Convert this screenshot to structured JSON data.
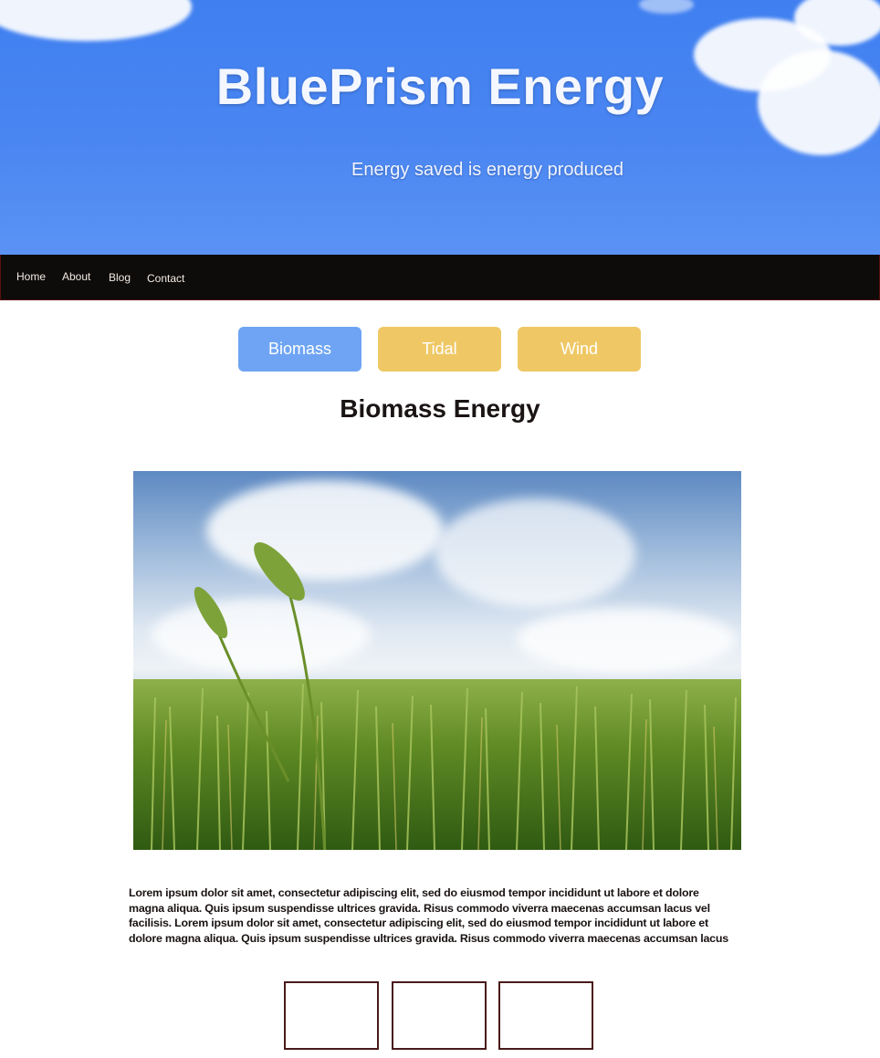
{
  "hero": {
    "title": "BluePrism Energy",
    "tagline": "Energy saved is energy produced"
  },
  "nav": {
    "items": [
      {
        "label": "Home"
      },
      {
        "label": "About"
      },
      {
        "label": "Blog"
      },
      {
        "label": "Contact"
      }
    ]
  },
  "tabs": [
    {
      "label": "Biomass",
      "active": true
    },
    {
      "label": "Tidal",
      "active": false
    },
    {
      "label": "Wind",
      "active": false
    }
  ],
  "section": {
    "title": "Biomass Energy",
    "image_icon": "wheat-field-image",
    "body": "Lorem ipsum dolor sit amet, consectetur adipiscing elit, sed do eiusmod tempor incididunt ut labore et dolore magna aliqua. Quis ipsum suspendisse ultrices gravida. Risus commodo viverra maecenas accumsan lacus vel facilisis. Lorem ipsum dolor sit amet, consectetur adipiscing elit, sed do eiusmod tempor incididunt ut labore et dolore magna aliqua. Quis ipsum suspendisse ultrices gravida. Risus commodo viverra maecenas accumsan lacus"
  },
  "colors": {
    "hero_sky": "#4a86f2",
    "nav_bg": "#0e0b0b",
    "tab_active": "#6ea4f3",
    "tab_inactive": "#efc865",
    "thumb_border": "#4a1a1a"
  }
}
